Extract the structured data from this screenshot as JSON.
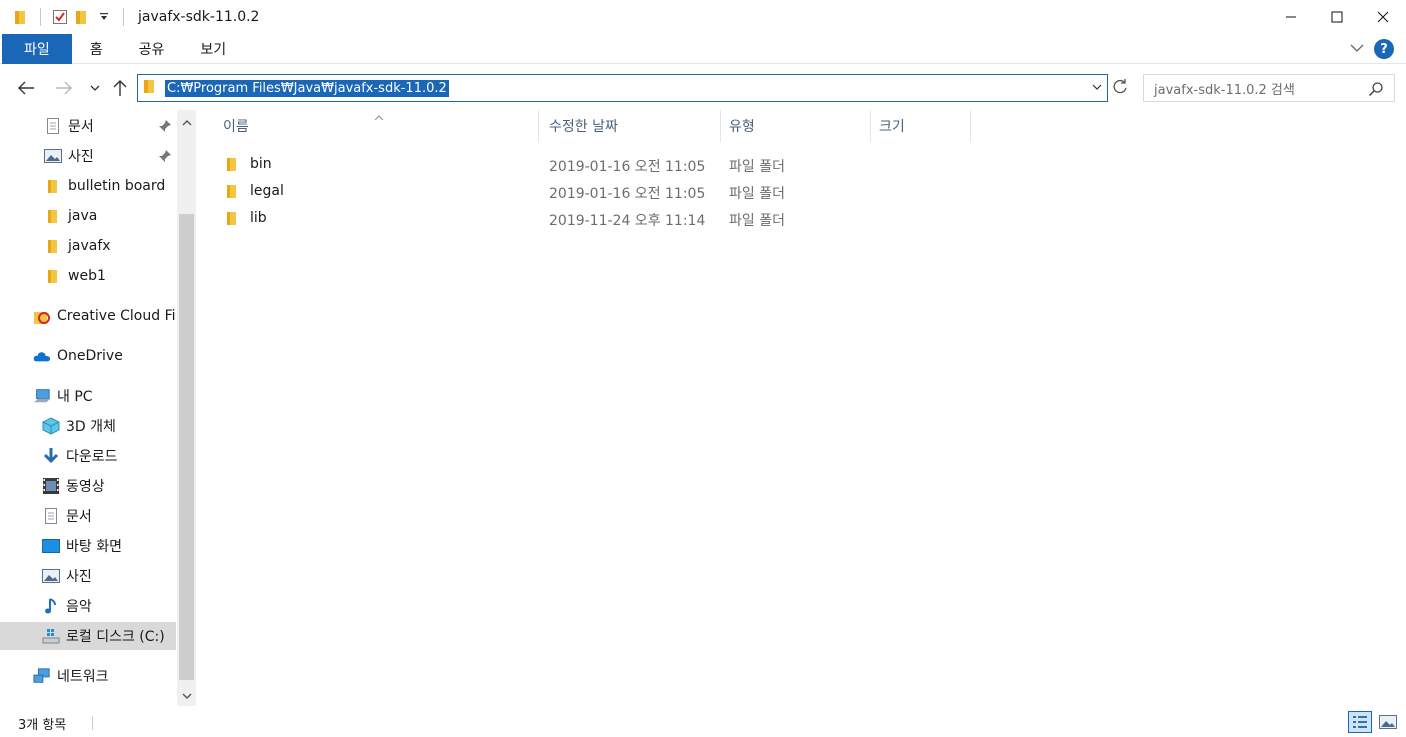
{
  "window": {
    "title": "javafx-sdk-11.0.2",
    "controls": {
      "minimize": "minimize",
      "maximize": "maximize",
      "close": "close"
    }
  },
  "ribbon": {
    "tabs": [
      {
        "label": "파일"
      },
      {
        "label": "홈"
      },
      {
        "label": "공유"
      },
      {
        "label": "보기"
      }
    ]
  },
  "nav": {
    "address": "C:₩Program Files₩Java₩javafx-sdk-11.0.2",
    "search_placeholder": "javafx-sdk-11.0.2 검색"
  },
  "sidebar": {
    "items": [
      {
        "label": "문서",
        "icon": "document-icon",
        "pinned": true
      },
      {
        "label": "사진",
        "icon": "pictures-icon",
        "pinned": true
      },
      {
        "label": "bulletin board",
        "icon": "folder-icon"
      },
      {
        "label": "java",
        "icon": "folder-icon"
      },
      {
        "label": "javafx",
        "icon": "folder-icon"
      },
      {
        "label": "web1",
        "icon": "folder-icon"
      },
      {
        "label": "Creative Cloud Fil",
        "icon": "creative-cloud-icon"
      },
      {
        "label": "OneDrive",
        "icon": "onedrive-icon"
      },
      {
        "label": "내 PC",
        "icon": "pc-icon"
      },
      {
        "label": "3D 개체",
        "icon": "3d-objects-icon"
      },
      {
        "label": "다운로드",
        "icon": "download-icon"
      },
      {
        "label": "동영상",
        "icon": "video-icon"
      },
      {
        "label": "문서",
        "icon": "document-icon"
      },
      {
        "label": "바탕 화면",
        "icon": "desktop-icon"
      },
      {
        "label": "사진",
        "icon": "pictures-icon"
      },
      {
        "label": "음악",
        "icon": "music-icon"
      },
      {
        "label": "로컬 디스크 (C:)",
        "icon": "drive-icon",
        "selected": true
      },
      {
        "label": "네트워크",
        "icon": "network-icon"
      }
    ]
  },
  "list": {
    "columns": [
      "이름",
      "수정한 날짜",
      "유형",
      "크기"
    ],
    "rows": [
      {
        "name": "bin",
        "date": "2019-01-16 오전 11:05",
        "type": "파일 폴더"
      },
      {
        "name": "legal",
        "date": "2019-01-16 오전 11:05",
        "type": "파일 폴더"
      },
      {
        "name": "lib",
        "date": "2019-11-24 오후 11:14",
        "type": "파일 폴더"
      }
    ]
  },
  "status": {
    "count": "3개 항목"
  },
  "colors": {
    "accent": "#1a67b7",
    "folder": "#f4c542",
    "header_text": "#4c607a"
  }
}
